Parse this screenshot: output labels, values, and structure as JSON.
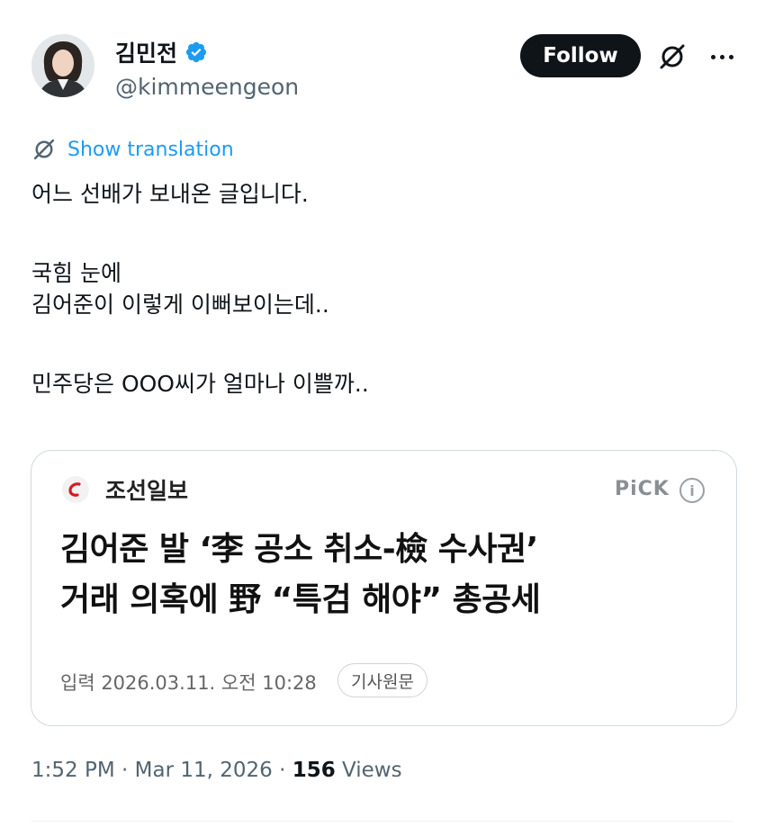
{
  "author": {
    "display_name": "김민전",
    "handle": "@kimmeengeon",
    "verified": true,
    "avatar_icon": "profile-avatar"
  },
  "actions": {
    "follow_label": "Follow",
    "grok_icon": "grok-icon",
    "more_icon": "more-icon"
  },
  "translation": {
    "icon": "translate-icon",
    "label": "Show translation"
  },
  "tweet": {
    "lines": [
      "어느 선배가 보내온 글입니다.",
      "국힘 눈에",
      "김어준이 이렇게 이뻐보이는데..",
      "민주당은 OOO씨가 얼마나 이쁠까.."
    ]
  },
  "card": {
    "source_name": "조선일보",
    "pick_label": "PiCK",
    "info_icon": "info-icon",
    "headline_line1": "김어준 발 ‘李 공소 취소-檢 수사권’",
    "headline_line2": "거래 의혹에 野 “특검 해야” 총공세",
    "date_text": "입력 2026.03.11. 오전 10:28",
    "original_label": "기사원문"
  },
  "meta": {
    "time": "1:52 PM",
    "separator": " · ",
    "date": "Mar 11, 2026",
    "views_count": "156",
    "views_label": "Views"
  },
  "colors": {
    "accent": "#1d9bf0",
    "text": "#0f1419",
    "secondary": "#536471",
    "follow_bg": "#0f1419",
    "logo_red": "#d71920"
  }
}
